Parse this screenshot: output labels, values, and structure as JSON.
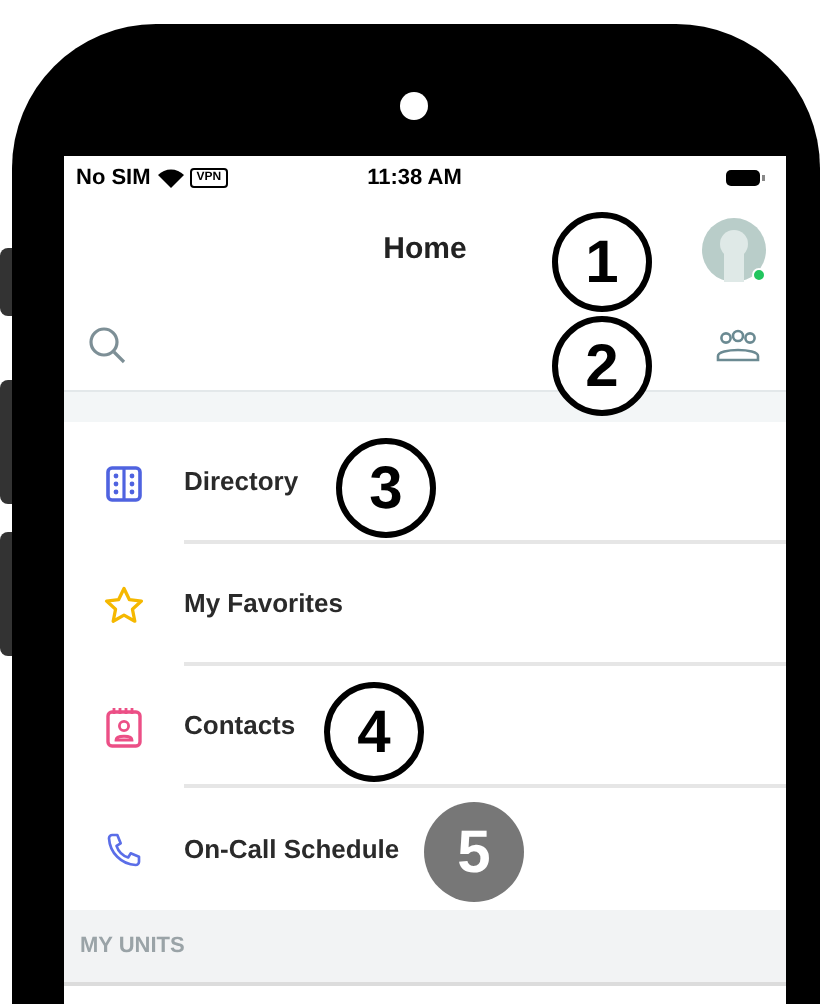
{
  "status_bar": {
    "carrier": "No SIM",
    "vpn": "VPN",
    "time": "11:38 AM"
  },
  "header": {
    "title": "Home",
    "avatar": {
      "online": true
    }
  },
  "menu": [
    {
      "label": "Directory",
      "kind": "directory"
    },
    {
      "label": "My Favorites",
      "kind": "favorites"
    },
    {
      "label": "Contacts",
      "kind": "contacts"
    },
    {
      "label": "On-Call Schedule",
      "kind": "schedule"
    }
  ],
  "section_header": "MY UNITS",
  "callouts": [
    {
      "number": "1",
      "kind": "outline"
    },
    {
      "number": "2",
      "kind": "outline"
    },
    {
      "number": "3",
      "kind": "outline"
    },
    {
      "number": "4",
      "kind": "outline"
    },
    {
      "number": "5",
      "kind": "filled"
    }
  ]
}
